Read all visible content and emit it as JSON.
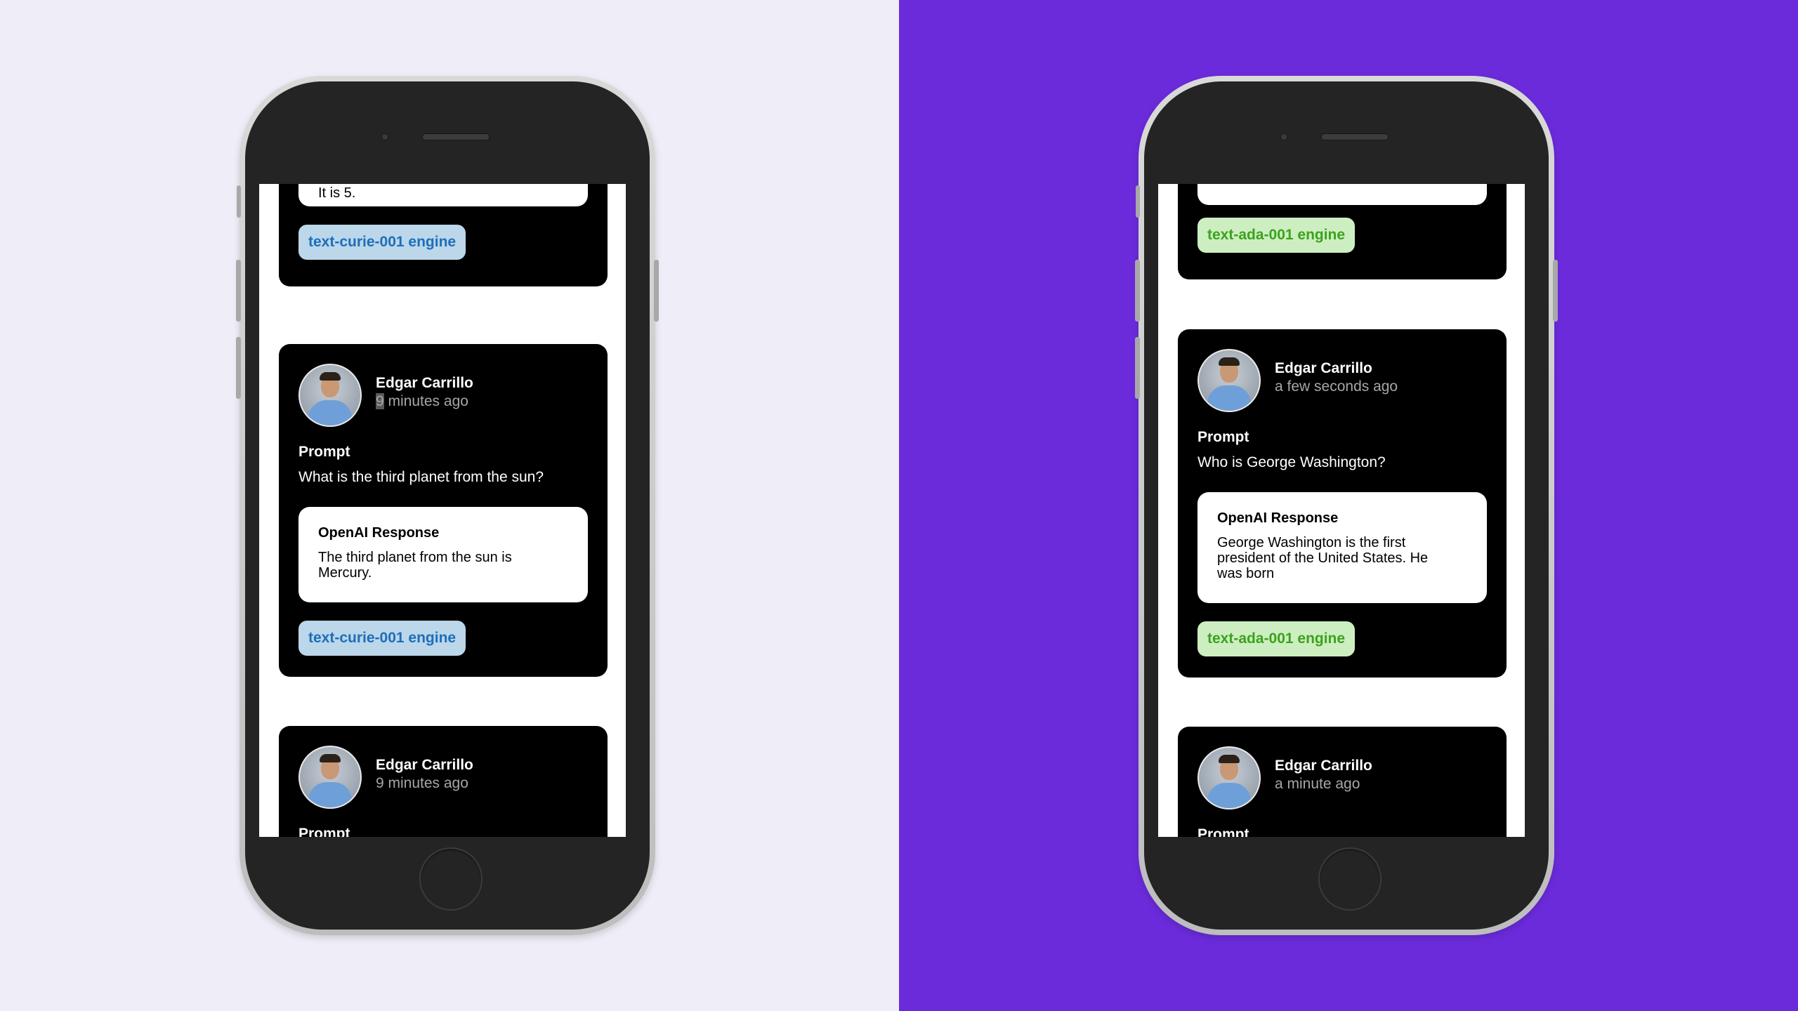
{
  "left_phone": {
    "top_card": {
      "response_tail": "It is 5.",
      "engine": "text-curie-001 engine"
    },
    "middle_card": {
      "user_name": "Edgar Carrillo",
      "time_highlight": "9",
      "time_rest": " minutes ago",
      "prompt_label": "Prompt",
      "prompt_text": "What is the third planet from the sun?",
      "response_title": "OpenAI Response",
      "response_text": "The third planet from the sun is Mercury.",
      "engine": "text-curie-001 engine"
    },
    "bottom_card": {
      "user_name": "Edgar Carrillo",
      "time": "9 minutes ago",
      "prompt_label": "Prompt"
    }
  },
  "right_phone": {
    "top_card": {
      "engine": "text-ada-001 engine"
    },
    "middle_card": {
      "user_name": "Edgar Carrillo",
      "time": "a few seconds ago",
      "prompt_label": "Prompt",
      "prompt_text": "Who is George Washington?",
      "response_title": "OpenAI Response",
      "response_text": "George Washington is the first president of the United States. He was born",
      "engine": "text-ada-001 engine"
    },
    "bottom_card": {
      "user_name": "Edgar Carrillo",
      "time": "a minute ago",
      "prompt_label": "Prompt"
    }
  },
  "colors": {
    "left_background": "#EFEEF8",
    "right_background": "#6B2BDB",
    "curie_badge_bg": "#bcd6ea",
    "curie_badge_text": "#1c6fb9",
    "ada_badge_bg": "#cdeec1",
    "ada_badge_text": "#3ba21d"
  }
}
